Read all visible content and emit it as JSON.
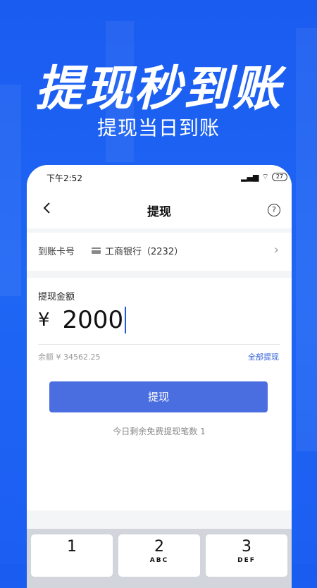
{
  "hero": {
    "title": "提现秒到账",
    "subtitle": "提现当日到账"
  },
  "status_bar": {
    "time": "下午2:52",
    "battery": "27"
  },
  "nav": {
    "title": "提现",
    "help": "?"
  },
  "card": {
    "label": "到账卡号",
    "bank": "工商银行（2232）"
  },
  "amount": {
    "label": "提现金额",
    "currency": "¥",
    "value": "2000"
  },
  "balance": {
    "text": "余额 ¥ 34562.25",
    "withdraw_all": "全部提现"
  },
  "submit_label": "提现",
  "free_note": "今日剩余免费提现笔数 1",
  "keyboard": {
    "keys": [
      {
        "num": "1",
        "letters": ""
      },
      {
        "num": "2",
        "letters": "ABC"
      },
      {
        "num": "3",
        "letters": "DEF"
      }
    ]
  },
  "colors": {
    "background": "#1f66f5",
    "accent": "#4a6ee0",
    "link": "#2f5fd6"
  }
}
